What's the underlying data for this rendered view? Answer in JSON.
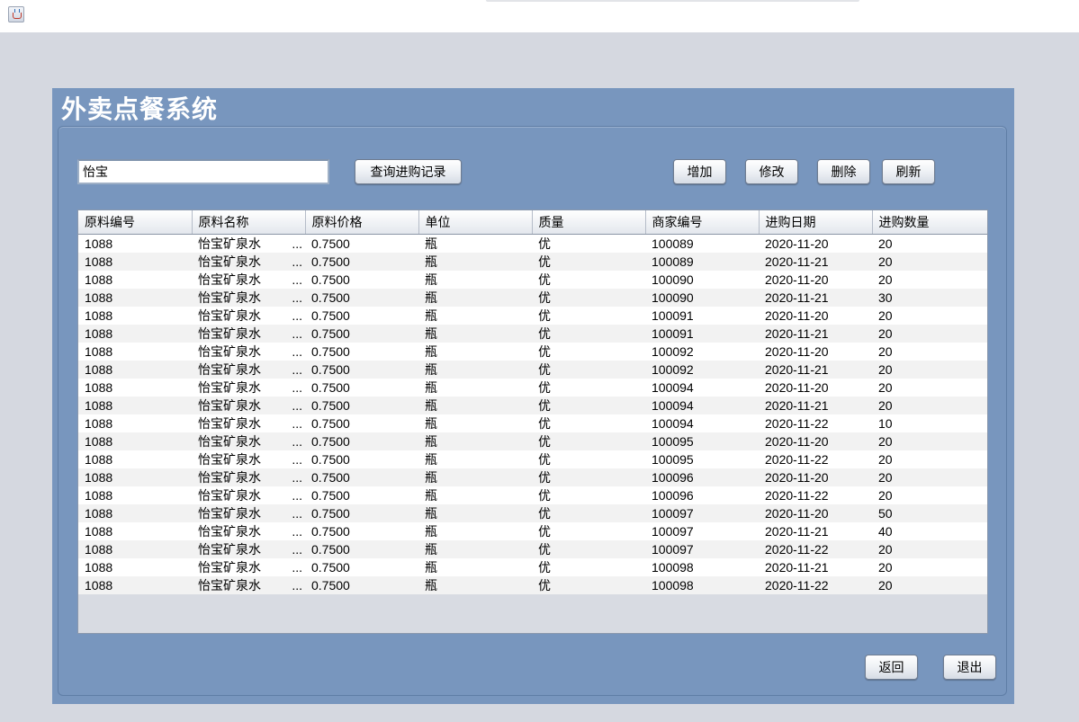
{
  "window": {
    "icon": "java-cup-icon"
  },
  "app": {
    "title": "外卖点餐系统"
  },
  "search": {
    "value": "怡宝",
    "button_label": "查询进购记录"
  },
  "toolbar": {
    "add": "增加",
    "edit": "修改",
    "delete": "删除",
    "refresh": "刷新"
  },
  "table": {
    "columns": [
      "原料编号",
      "原料名称",
      "原料价格",
      "单位",
      "质量",
      "商家编号",
      "进购日期",
      "进购数量"
    ],
    "rows": [
      [
        "1088",
        "怡宝矿泉水",
        "0.7500",
        "瓶",
        "优",
        "100089",
        "2020-11-20",
        "20"
      ],
      [
        "1088",
        "怡宝矿泉水",
        "0.7500",
        "瓶",
        "优",
        "100089",
        "2020-11-21",
        "20"
      ],
      [
        "1088",
        "怡宝矿泉水",
        "0.7500",
        "瓶",
        "优",
        "100090",
        "2020-11-20",
        "20"
      ],
      [
        "1088",
        "怡宝矿泉水",
        "0.7500",
        "瓶",
        "优",
        "100090",
        "2020-11-21",
        "30"
      ],
      [
        "1088",
        "怡宝矿泉水",
        "0.7500",
        "瓶",
        "优",
        "100091",
        "2020-11-20",
        "20"
      ],
      [
        "1088",
        "怡宝矿泉水",
        "0.7500",
        "瓶",
        "优",
        "100091",
        "2020-11-21",
        "20"
      ],
      [
        "1088",
        "怡宝矿泉水",
        "0.7500",
        "瓶",
        "优",
        "100092",
        "2020-11-20",
        "20"
      ],
      [
        "1088",
        "怡宝矿泉水",
        "0.7500",
        "瓶",
        "优",
        "100092",
        "2020-11-21",
        "20"
      ],
      [
        "1088",
        "怡宝矿泉水",
        "0.7500",
        "瓶",
        "优",
        "100094",
        "2020-11-20",
        "20"
      ],
      [
        "1088",
        "怡宝矿泉水",
        "0.7500",
        "瓶",
        "优",
        "100094",
        "2020-11-21",
        "20"
      ],
      [
        "1088",
        "怡宝矿泉水",
        "0.7500",
        "瓶",
        "优",
        "100094",
        "2020-11-22",
        "10"
      ],
      [
        "1088",
        "怡宝矿泉水",
        "0.7500",
        "瓶",
        "优",
        "100095",
        "2020-11-20",
        "20"
      ],
      [
        "1088",
        "怡宝矿泉水",
        "0.7500",
        "瓶",
        "优",
        "100095",
        "2020-11-22",
        "20"
      ],
      [
        "1088",
        "怡宝矿泉水",
        "0.7500",
        "瓶",
        "优",
        "100096",
        "2020-11-20",
        "20"
      ],
      [
        "1088",
        "怡宝矿泉水",
        "0.7500",
        "瓶",
        "优",
        "100096",
        "2020-11-22",
        "20"
      ],
      [
        "1088",
        "怡宝矿泉水",
        "0.7500",
        "瓶",
        "优",
        "100097",
        "2020-11-20",
        "50"
      ],
      [
        "1088",
        "怡宝矿泉水",
        "0.7500",
        "瓶",
        "优",
        "100097",
        "2020-11-21",
        "40"
      ],
      [
        "1088",
        "怡宝矿泉水",
        "0.7500",
        "瓶",
        "优",
        "100097",
        "2020-11-22",
        "20"
      ],
      [
        "1088",
        "怡宝矿泉水",
        "0.7500",
        "瓶",
        "优",
        "100098",
        "2020-11-21",
        "20"
      ],
      [
        "1088",
        "怡宝矿泉水",
        "0.7500",
        "瓶",
        "优",
        "100098",
        "2020-11-22",
        "20"
      ]
    ],
    "truncation_marker": "..."
  },
  "footer": {
    "back": "返回",
    "exit": "退出"
  },
  "colors": {
    "panel": "#7896be",
    "background": "#d5d8e0",
    "title": "#ffffff"
  }
}
